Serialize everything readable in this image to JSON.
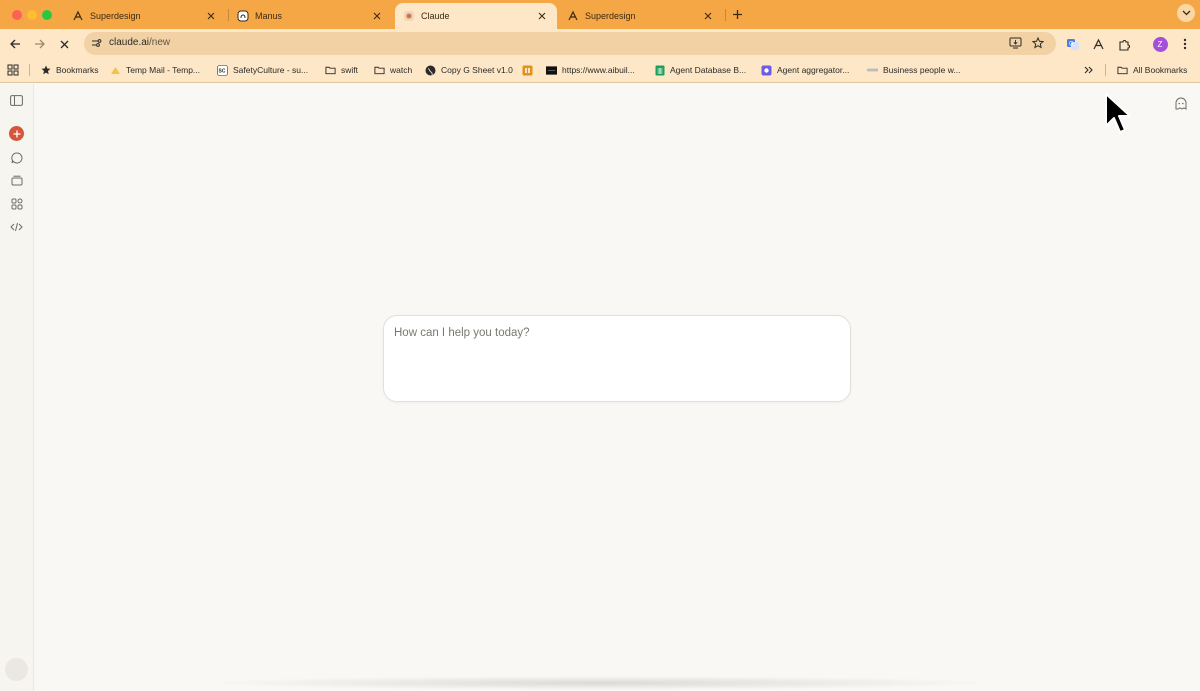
{
  "browser": {
    "tabs": [
      {
        "title": "Superdesign",
        "icon": "superdesign-icon",
        "active": false
      },
      {
        "title": "Manus",
        "icon": "manus-icon",
        "active": false
      },
      {
        "title": "Claude",
        "icon": "claude-icon",
        "active": true
      },
      {
        "title": "Superdesign",
        "icon": "superdesign-icon",
        "active": false
      }
    ],
    "address": {
      "host": "claude.ai",
      "path": "/new"
    },
    "bookmarks": [
      {
        "label": "Bookmarks",
        "icon": "star-icon"
      },
      {
        "label": "Temp Mail - Temp...",
        "icon": "mail-icon"
      },
      {
        "label": "SafetyCulture - su...",
        "icon": "safetyculture-icon"
      },
      {
        "label": "swift",
        "icon": "folder-icon"
      },
      {
        "label": "watch",
        "icon": "folder-icon"
      },
      {
        "label": "Copy G Sheet v1.0",
        "icon": "globe-icon"
      },
      {
        "label": "https://www.aibuil...",
        "icon": "site-icon"
      },
      {
        "label": "Agent Database B...",
        "icon": "sheets-icon"
      },
      {
        "label": "Agent aggregator...",
        "icon": "app-icon"
      },
      {
        "label": "Business people w...",
        "icon": "site-icon"
      }
    ],
    "all_bookmarks": "All Bookmarks",
    "profile_initial": "Z",
    "colors": {
      "tabstrip": "#f6a745",
      "toolbar": "#fde7c7",
      "accent": "#d4573b",
      "profile": "#a24fd9"
    }
  },
  "composer": {
    "placeholder": "How can I help you today?"
  }
}
